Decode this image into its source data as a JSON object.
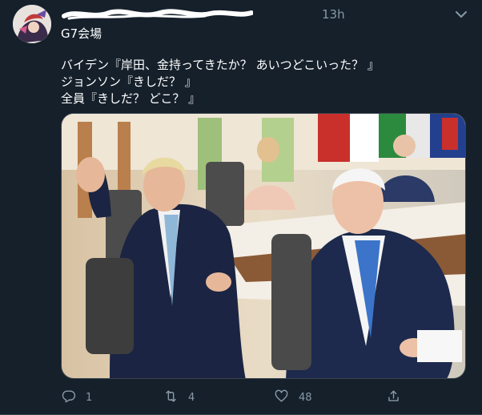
{
  "tweet": {
    "timestamp": "13h",
    "lines": [
      "G7会場",
      "バイデン『岸田、金持ってきたか？ あいつどこいった？ 』",
      "ジョンソン『きしだ？ 』",
      "全員『きしだ？ どこ？ 』"
    ]
  },
  "actions": {
    "reply_count": "1",
    "retweet_count": "4",
    "like_count": "48"
  },
  "icons": {
    "reply": "reply-icon",
    "retweet": "retweet-icon",
    "like": "heart-icon",
    "share": "share-icon",
    "more": "chevron-down-icon"
  },
  "colors": {
    "background": "#15202b",
    "secondary_text": "#8899a6",
    "border": "#38444d"
  }
}
